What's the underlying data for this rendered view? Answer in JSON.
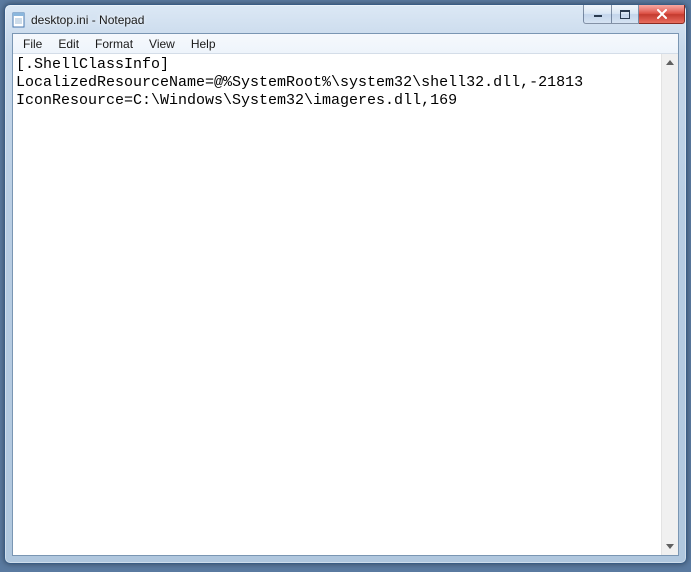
{
  "window": {
    "title": "desktop.ini - Notepad"
  },
  "menubar": {
    "items": [
      "File",
      "Edit",
      "Format",
      "View",
      "Help"
    ]
  },
  "editor": {
    "content": "[.ShellClassInfo]\nLocalizedResourceName=@%SystemRoot%\\system32\\shell32.dll,-21813\nIconResource=C:\\Windows\\System32\\imageres.dll,169"
  }
}
